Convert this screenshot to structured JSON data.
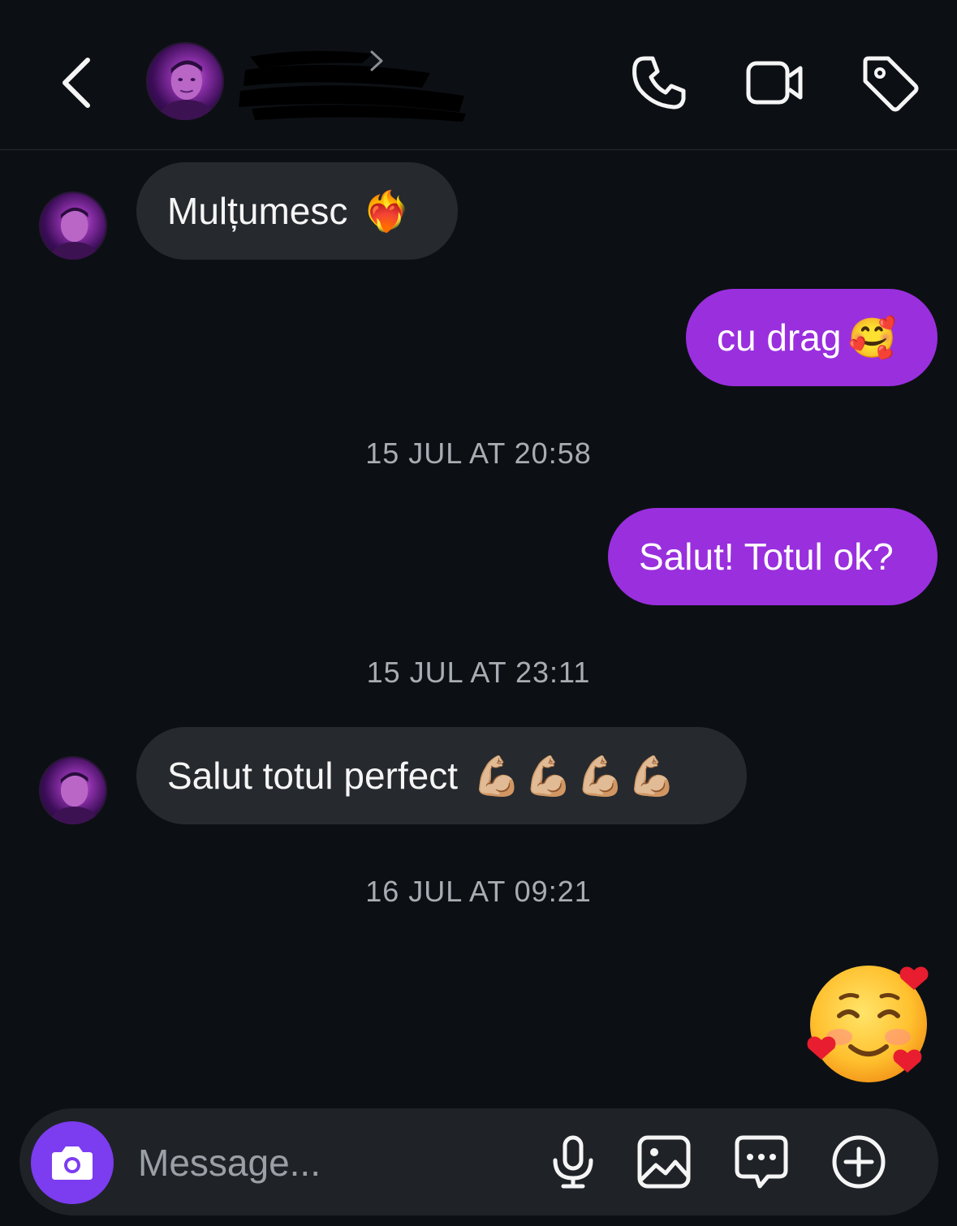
{
  "header": {
    "back_icon": "chevron-left-icon",
    "contact_name": "",
    "contact_status": "",
    "actions": [
      {
        "id": "call",
        "icon": "phone-icon"
      },
      {
        "id": "video",
        "icon": "video-camera-icon"
      },
      {
        "id": "tag",
        "icon": "tag-icon"
      }
    ]
  },
  "messages": [
    {
      "direction": "incoming",
      "text": "Mulțumesc",
      "emoji": "❤️‍🔥"
    },
    {
      "direction": "outgoing",
      "text": "cu drag",
      "emoji": "🥰"
    },
    {
      "type": "timestamp",
      "text": "15 JUL AT 20:58"
    },
    {
      "direction": "outgoing",
      "text": "Salut! Totul ok?"
    },
    {
      "type": "timestamp",
      "text": "15 JUL AT 23:11"
    },
    {
      "direction": "incoming",
      "text": "Salut totul perfect",
      "emoji": "💪🏼💪🏼💪🏼💪🏼"
    },
    {
      "type": "timestamp",
      "text": "16 JUL AT 09:21"
    },
    {
      "direction": "outgoing",
      "type": "large-emoji",
      "emoji": "🥰"
    }
  ],
  "composer": {
    "placeholder": "Message...",
    "icons": [
      "camera-icon",
      "microphone-icon",
      "gallery-icon",
      "sticker-chat-icon",
      "plus-circle-icon"
    ]
  },
  "colors": {
    "background": "#0c1014",
    "incoming_bubble": "#262a2f",
    "outgoing_bubble": "#9a2fde",
    "camera_button": "#7c3cf0",
    "timestamp_text": "#a8adb4"
  }
}
